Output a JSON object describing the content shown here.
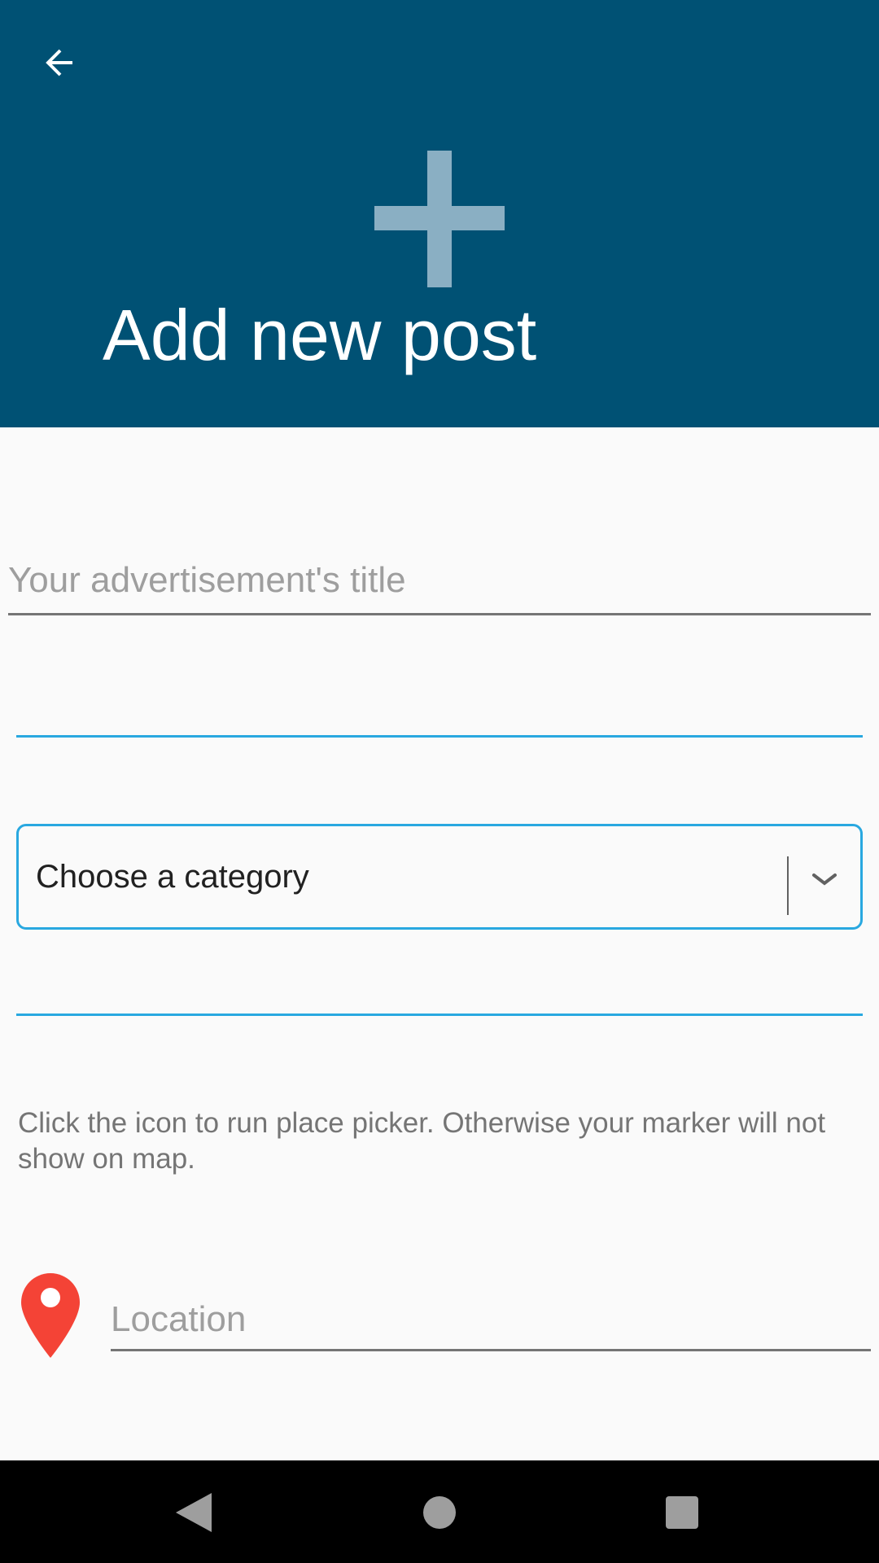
{
  "header": {
    "back_icon": "arrow-left-icon",
    "hero_icon": "plus-icon",
    "title": "Add new post",
    "background_color": "#005174"
  },
  "form": {
    "title_field": {
      "placeholder": "Your advertisement's title",
      "value": ""
    },
    "field_1": {
      "value": ""
    },
    "category": {
      "selected": "Choose a category",
      "icon": "chevron-down-icon"
    },
    "field_2": {
      "value": ""
    },
    "hint": "Click the icon to run place picker. Otherwise your marker will not show on map.",
    "location": {
      "icon": "location-pin-icon",
      "placeholder": "Location",
      "value": ""
    }
  },
  "colors": {
    "accent": "#29a8e0",
    "pin": "#f44336",
    "hero_icon": "#8aafc3"
  },
  "navbar": {
    "back_icon": "nav-back-icon",
    "home_icon": "nav-home-icon",
    "recents_icon": "nav-recents-icon"
  }
}
